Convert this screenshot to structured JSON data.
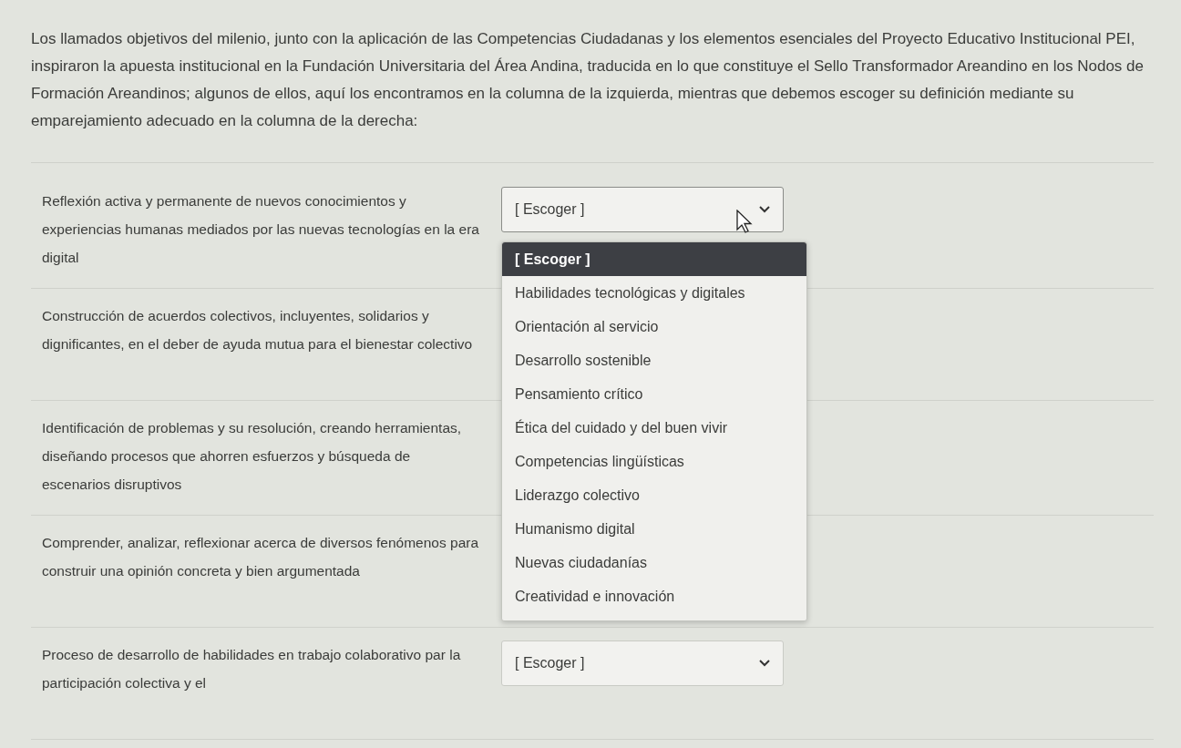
{
  "intro": "Los llamados objetivos del milenio, junto con la aplicación de las Competencias Ciudadanas y los elementos esenciales del Proyecto Educativo Institucional PEI, inspiraron la apuesta institucional en la Fundación Universitaria del Área Andina, traducida en lo que constituye el Sello Transformador Areandino en los Nodos de Formación Areandinos; algunos de ellos, aquí los encontramos en la columna de la izquierda, mientras que debemos escoger su definición mediante su emparejamiento adecuado en la columna de la derecha:",
  "pairs": [
    {
      "prompt": "Reflexión activa y permanente de nuevos conocimientos y experiencias humanas mediados por las nuevas tecnologías en la era digital",
      "select": {
        "value": "[ Escoger ]",
        "open": true
      }
    },
    {
      "prompt": "Construcción de acuerdos colectivos, incluyentes, solidarios y dignificantes, en el deber de ayuda mutua para el bienestar colectivo"
    },
    {
      "prompt": "Identificación de problemas y su resolución, creando herramientas, diseñando procesos que ahorren esfuerzos y búsqueda de escenarios disruptivos"
    },
    {
      "prompt": "Comprender, analizar, reflexionar acerca de diversos fenómenos para construir una opinión concreta y bien argumentada"
    },
    {
      "prompt": "Proceso de desarrollo de habilidades en trabajo colaborativo par la participación colectiva y el",
      "select": {
        "value": "[ Escoger ]",
        "open": false
      }
    }
  ],
  "dropdown": {
    "options": [
      {
        "label": "[ Escoger ]",
        "selected": true
      },
      {
        "label": "Habilidades tecnológicas y digitales",
        "selected": false
      },
      {
        "label": "Orientación al servicio",
        "selected": false
      },
      {
        "label": "Desarrollo sostenible",
        "selected": false
      },
      {
        "label": "Pensamiento crítico",
        "selected": false
      },
      {
        "label": "Ética del cuidado y del buen vivir",
        "selected": false
      },
      {
        "label": "Competencias lingüísticas",
        "selected": false
      },
      {
        "label": "Liderazgo colectivo",
        "selected": false
      },
      {
        "label": "Humanismo digital",
        "selected": false
      },
      {
        "label": "Nuevas ciudadanías",
        "selected": false
      },
      {
        "label": "Creatividad e innovación",
        "selected": false
      }
    ]
  }
}
